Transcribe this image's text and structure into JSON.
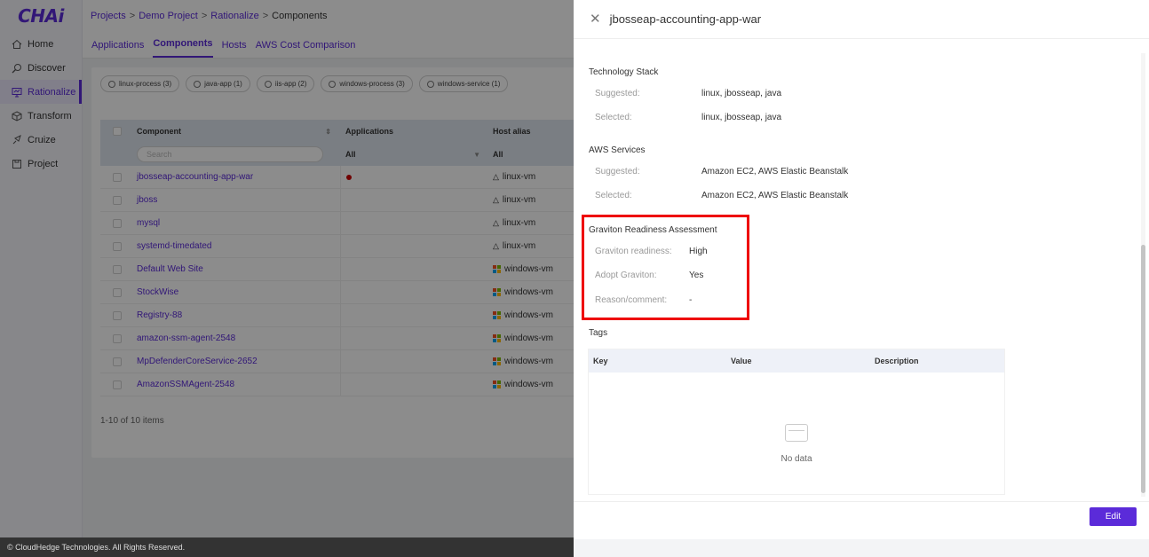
{
  "app": {
    "logo": "CHAi"
  },
  "sidebar": {
    "items": [
      {
        "label": "Home",
        "icon": "home-icon"
      },
      {
        "label": "Discover",
        "icon": "discover-icon"
      },
      {
        "label": "Rationalize",
        "icon": "rationalize-icon",
        "active": true
      },
      {
        "label": "Transform",
        "icon": "transform-icon"
      },
      {
        "label": "Cruize",
        "icon": "cruize-icon"
      },
      {
        "label": "Project",
        "icon": "project-icon"
      }
    ]
  },
  "breadcrumb": {
    "items": [
      "Projects",
      "Demo Project",
      "Rationalize"
    ],
    "current": "Components"
  },
  "subtabs": [
    "Applications",
    "Components",
    "Hosts",
    "AWS Cost Comparison"
  ],
  "filters": [
    "linux-process (3)",
    "java-app (1)",
    "iis-app (2)",
    "windows-process (3)",
    "windows-service (1)"
  ],
  "table": {
    "headers": {
      "component": "Component",
      "applications": "Applications",
      "host": "Host alias"
    },
    "search_placeholder": "Search",
    "filter_all_app": "All",
    "filter_all_host": "All",
    "rows": [
      {
        "component": "jbosseap-accounting-app-war",
        "app_dot": true,
        "host": "linux-vm",
        "os": "linux"
      },
      {
        "component": "jboss",
        "app_dot": false,
        "host": "linux-vm",
        "os": "linux"
      },
      {
        "component": "mysql",
        "app_dot": false,
        "host": "linux-vm",
        "os": "linux"
      },
      {
        "component": "systemd-timedated",
        "app_dot": false,
        "host": "linux-vm",
        "os": "linux"
      },
      {
        "component": "Default Web Site",
        "app_dot": false,
        "host": "windows-vm",
        "os": "windows"
      },
      {
        "component": "StockWise",
        "app_dot": false,
        "host": "windows-vm",
        "os": "windows"
      },
      {
        "component": "Registry-88",
        "app_dot": false,
        "host": "windows-vm",
        "os": "windows"
      },
      {
        "component": "amazon-ssm-agent-2548",
        "app_dot": false,
        "host": "windows-vm",
        "os": "windows"
      },
      {
        "component": "MpDefenderCoreService-2652",
        "app_dot": false,
        "host": "windows-vm",
        "os": "windows"
      },
      {
        "component": "AmazonSSMAgent-2548",
        "app_dot": false,
        "host": "windows-vm",
        "os": "windows"
      }
    ],
    "pagination": "1-10 of 10 items"
  },
  "footer": "© CloudHedge Technologies. All Rights Reserved.",
  "drawer": {
    "title": "jbosseap-accounting-app-war",
    "tech_stack": {
      "title": "Technology Stack",
      "suggested_label": "Suggested:",
      "suggested": "linux, jbosseap, java",
      "selected_label": "Selected:",
      "selected": "linux, jbosseap, java"
    },
    "aws_services": {
      "title": "AWS Services",
      "suggested_label": "Suggested:",
      "suggested": "Amazon EC2, AWS Elastic Beanstalk",
      "selected_label": "Selected:",
      "selected": "Amazon EC2, AWS Elastic Beanstalk"
    },
    "graviton": {
      "title": "Graviton Readiness Assessment",
      "readiness_label": "Graviton readiness:",
      "readiness": "High",
      "adopt_label": "Adopt Graviton:",
      "adopt": "Yes",
      "reason_label": "Reason/comment:",
      "reason": "-"
    },
    "tags": {
      "title": "Tags",
      "headers": [
        "Key",
        "Value",
        "Description"
      ],
      "empty": "No data"
    },
    "edit_label": "Edit"
  },
  "colors": {
    "accent": "#5b2bd9",
    "highlight": "#e00000"
  }
}
